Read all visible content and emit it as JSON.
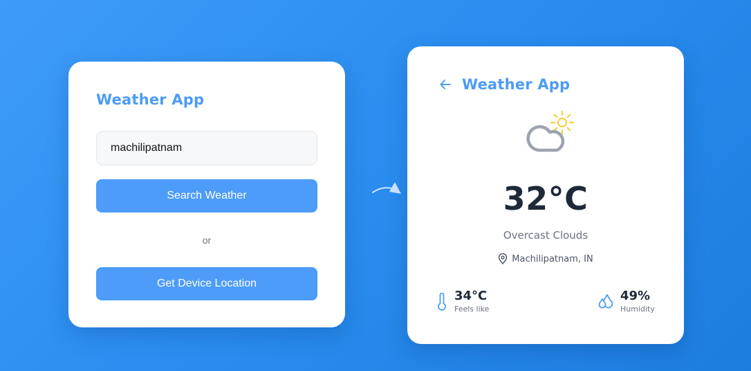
{
  "search_card": {
    "title": "Weather App",
    "city_input_value": "machilipatnam",
    "search_button_label": "Search Weather",
    "or_text": "or",
    "location_button_label": "Get Device Location"
  },
  "result_card": {
    "title": "Weather App",
    "back_icon": "arrow-left-icon",
    "weather_icon": "cloud-sun-icon",
    "temperature": "32°C",
    "description": "Overcast Clouds",
    "location": "Machilipatnam, IN",
    "feels_like": {
      "value": "34°C",
      "label": "Feels like",
      "icon": "thermometer-icon"
    },
    "humidity": {
      "value": "49%",
      "label": "Humidity",
      "icon": "droplets-icon"
    }
  },
  "colors": {
    "accent": "#4d9cf3",
    "button": "#4d9cf9",
    "sun": "#f7d046",
    "cloud": "#9ca3af",
    "background_start": "#3f9bf7",
    "background_end": "#1d7ddf"
  }
}
